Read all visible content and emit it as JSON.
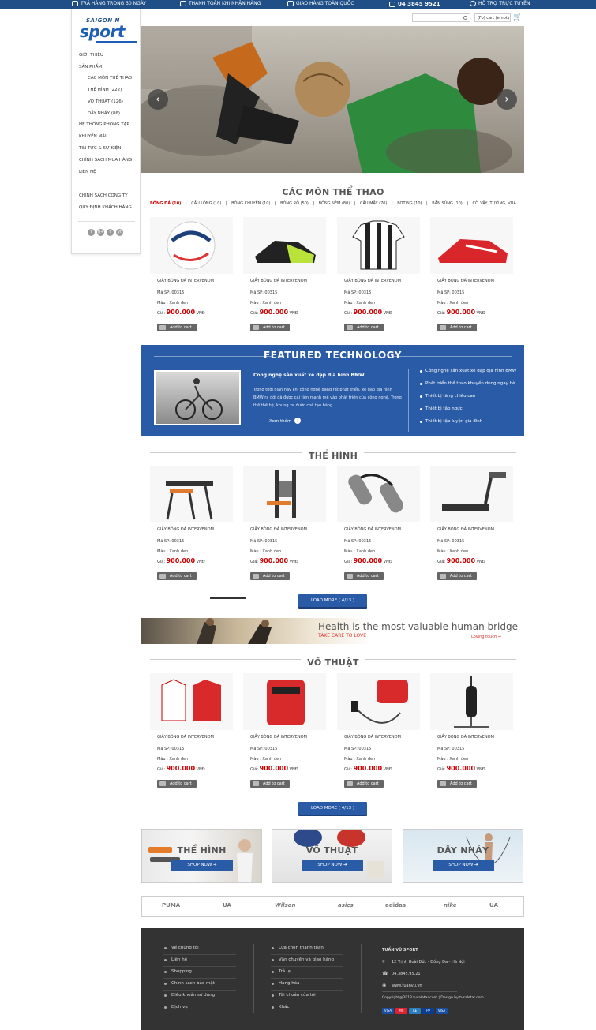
{
  "topbar": {
    "items": [
      "TRẢ HÀNG TRONG 30 NGÀY",
      "THANH TOÁN KHI NHẬN HÀNG",
      "GIAO HÀNG TOÀN QUỐC",
      "04 3845 9521",
      "HỖ TRỢ TRỰC TUYẾN"
    ]
  },
  "logo": {
    "small": "SAIGON N",
    "big": "sport"
  },
  "nav": {
    "items": [
      "GIỚI THIỆU",
      "SẢN PHẨM",
      "CÁC MÔN THỂ THAO",
      "THỂ HÌNH (222)",
      "VÕ THUẬT (126)",
      "DÂY NHẢY (86)",
      "HỆ THỐNG PHÒNG TẬP",
      "KHUYẾN MÃI",
      "TIN TỨC & SỰ KIỆN",
      "CHÍNH SÁCH MUA HÀNG",
      "LIÊN HỆ",
      "CHÍNH SÁCH CÔNG TY",
      "QUY ĐỊNH KHÁCH HÀNG"
    ],
    "social": [
      "f",
      "g+",
      "t",
      "yt"
    ]
  },
  "search": {
    "placeholder": ""
  },
  "cart": {
    "text": "(Fo) cart (empty)"
  },
  "slider": {
    "prev": "‹",
    "next": "›"
  },
  "sections": {
    "s1": "CÁC MÔN THỂ THAO",
    "s2": "THỂ HÌNH",
    "s3": "VÕ THUẬT"
  },
  "tabs": [
    "BÓNG ĐÁ (10)",
    "CẦU LÔNG (10)",
    "BÓNG CHUYỀN (10)",
    "BÓNG RỔ (50)",
    "BÓNG NÉM (80)",
    "CẦU MÂY (70)",
    "BOTING (10)",
    "BẮN SÚNG (10)",
    "CỜ VÂY, TƯỚNG, VUA"
  ],
  "product": {
    "name": "GIẦY BÓNG ĐÁ INTERVENOM",
    "name_alt": "GIẦY BÓNG ĐÁ INTERVENOM",
    "code": "Mã SP: 00315",
    "color": "Màu : Xanh đen",
    "price_label": "Giá:",
    "price": "900.000",
    "currency": "VNĐ",
    "cart": "Add to cart"
  },
  "featured": {
    "title": "FEATURED TECHNOLOGY",
    "headline": "Công nghệ sản xuất xe đạp địa hình BMW",
    "desc": "Trong thời gian này khi công nghệ đang rất phát triển, xe đạp địa hình BMW ra đời đã được cải tiến mạnh mẽ vào phát triển của công nghệ. Trong thể thể hệ, khung xe được chế tạo bằng ...",
    "more": "Xem thêm",
    "list": [
      "Công nghệ sản xuất xe đạp địa hình BMW",
      "Phát triển thể thao khuyến dùng ngày hè",
      "Thiết bị tăng chiều cao",
      "Thiết bị tập ngực",
      "Thiết bị tập luyện gia đình"
    ]
  },
  "loadmore": {
    "l1": "LOAD MORE ( 4/13 )",
    "l2": "LOAD MORE ( 4/13 )"
  },
  "banner": {
    "headline": "Health is the most valuable human bridge",
    "sub": "TAKE CARE TO LOVE",
    "tag": "Loving touch ➔"
  },
  "catbanners": [
    {
      "title": "THỂ HÌNH",
      "shop": "SHOP NOW ➔"
    },
    {
      "title": "VÕ THUẬT",
      "shop": "SHOP NOW ➔"
    },
    {
      "title": "DÂY NHẢY",
      "shop": "SHOP NOW ➔"
    }
  ],
  "brands": [
    "PUMA",
    "UA",
    "Wilson",
    "asics",
    "adidas",
    "nike",
    "UA"
  ],
  "footer": {
    "col1": [
      "Về chúng tôi",
      "Liên hệ",
      "Shopping",
      "Chính sách bảo mật",
      "Điều khoản sử dụng",
      "Dịch vụ"
    ],
    "col2": [
      "Lựa chọn thanh toán",
      "Vận chuyển và giao hàng",
      "Trả lại",
      "Hàng hóa",
      "Tài khoản của tôi",
      "Khác"
    ],
    "company": "TUẤN VŨ SPORT",
    "address": "12 Trịnh Hoài Đức - Đống Đa - Hà Nội",
    "phone": "04.3845.95.21",
    "web": "www.tuanvu.vn",
    "copyright": "Copyright@2013 tvsaletar.com | Design by tvsaletar.com",
    "pay": [
      "VISA",
      "MC",
      "AE",
      "PP",
      "VISA"
    ]
  },
  "colors": {
    "primary": "#2a5ba6",
    "topbar": "#1f4f86",
    "price": "#cc0000",
    "footer": "#333333"
  }
}
